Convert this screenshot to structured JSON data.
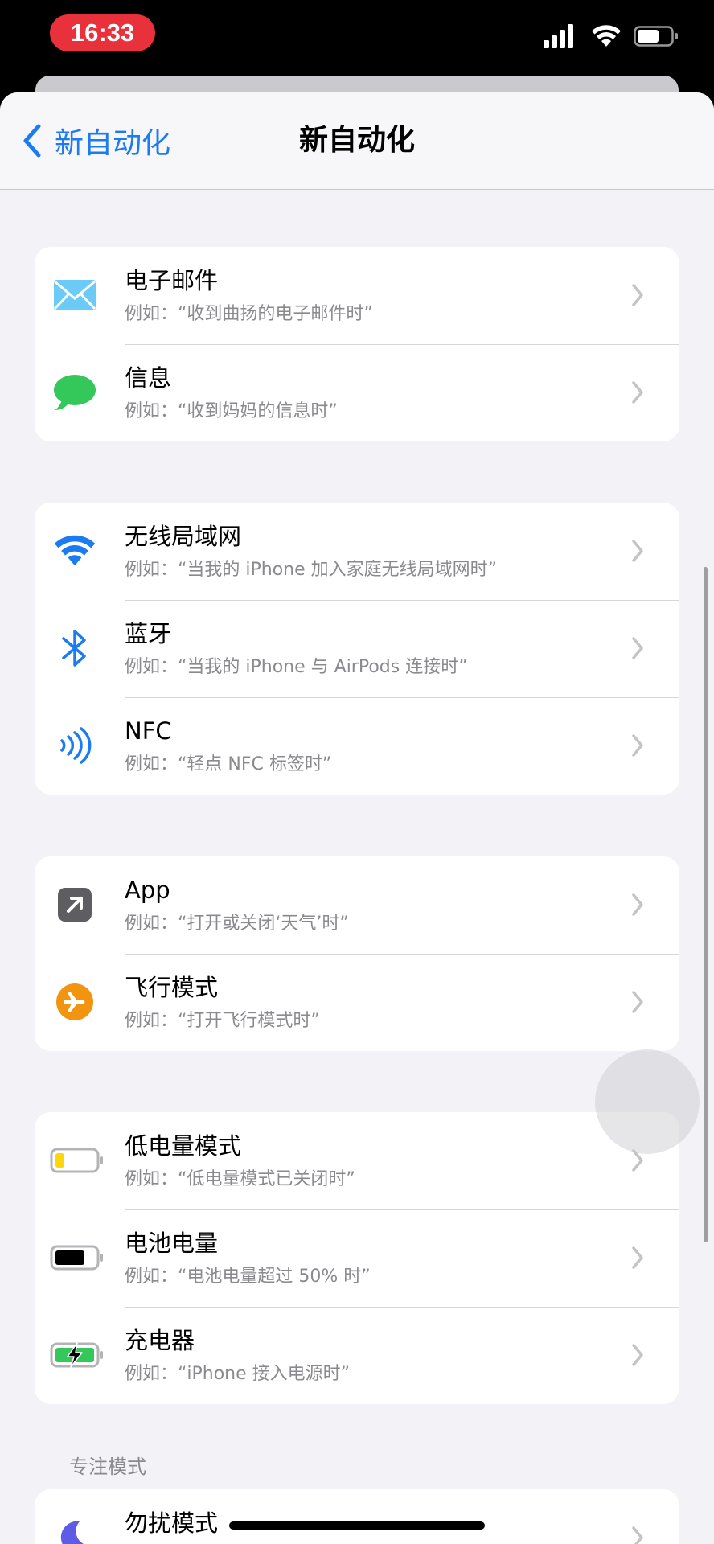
{
  "status_bar": {
    "time": "16:33",
    "signal_icon": "cellular-signal-icon",
    "wifi_icon": "wifi-icon",
    "battery_icon": "battery-icon"
  },
  "navbar": {
    "back_label": "新自动化",
    "title": "新自动化"
  },
  "groups": [
    {
      "rows": [
        {
          "icon": "mail-icon",
          "title": "电子邮件",
          "subtitle": "例如：“收到曲扬的电子邮件时”"
        },
        {
          "icon": "message-bubble-icon",
          "title": "信息",
          "subtitle": "例如：“收到妈妈的信息时”"
        }
      ]
    },
    {
      "rows": [
        {
          "icon": "wifi-icon",
          "title": "无线局域网",
          "subtitle": "例如：“当我的 iPhone 加入家庭无线局域网时”"
        },
        {
          "icon": "bluetooth-icon",
          "title": "蓝牙",
          "subtitle": "例如：“当我的 iPhone 与 AirPods 连接时”"
        },
        {
          "icon": "nfc-icon",
          "title": "NFC",
          "subtitle": "例如：“轻点 NFC 标签时”"
        }
      ]
    },
    {
      "rows": [
        {
          "icon": "app-arrow-icon",
          "title": "App",
          "subtitle": "例如：“打开或关闭‘天气’时”"
        },
        {
          "icon": "airplane-icon",
          "title": "飞行模式",
          "subtitle": "例如：“打开飞行模式时”"
        }
      ]
    },
    {
      "rows": [
        {
          "icon": "low-battery-icon",
          "title": "低电量模式",
          "subtitle": "例如：“低电量模式已关闭时”"
        },
        {
          "icon": "battery-level-icon",
          "title": "电池电量",
          "subtitle": "例如：“电池电量超过 50% 时”"
        },
        {
          "icon": "charger-icon",
          "title": "充电器",
          "subtitle": "例如：“iPhone 接入电源时”"
        }
      ]
    }
  ],
  "focus_section": {
    "header": "专注模式",
    "rows": [
      {
        "icon": "moon-icon",
        "title": "勿扰模式"
      }
    ]
  },
  "colors": {
    "accent": "#1b7bf0",
    "time_pill": "#e8313a",
    "messages_green": "#34c759",
    "airplane_orange": "#f2940f",
    "low_power_yellow": "#ffd60a",
    "moon_purple": "#5e5ce6"
  }
}
